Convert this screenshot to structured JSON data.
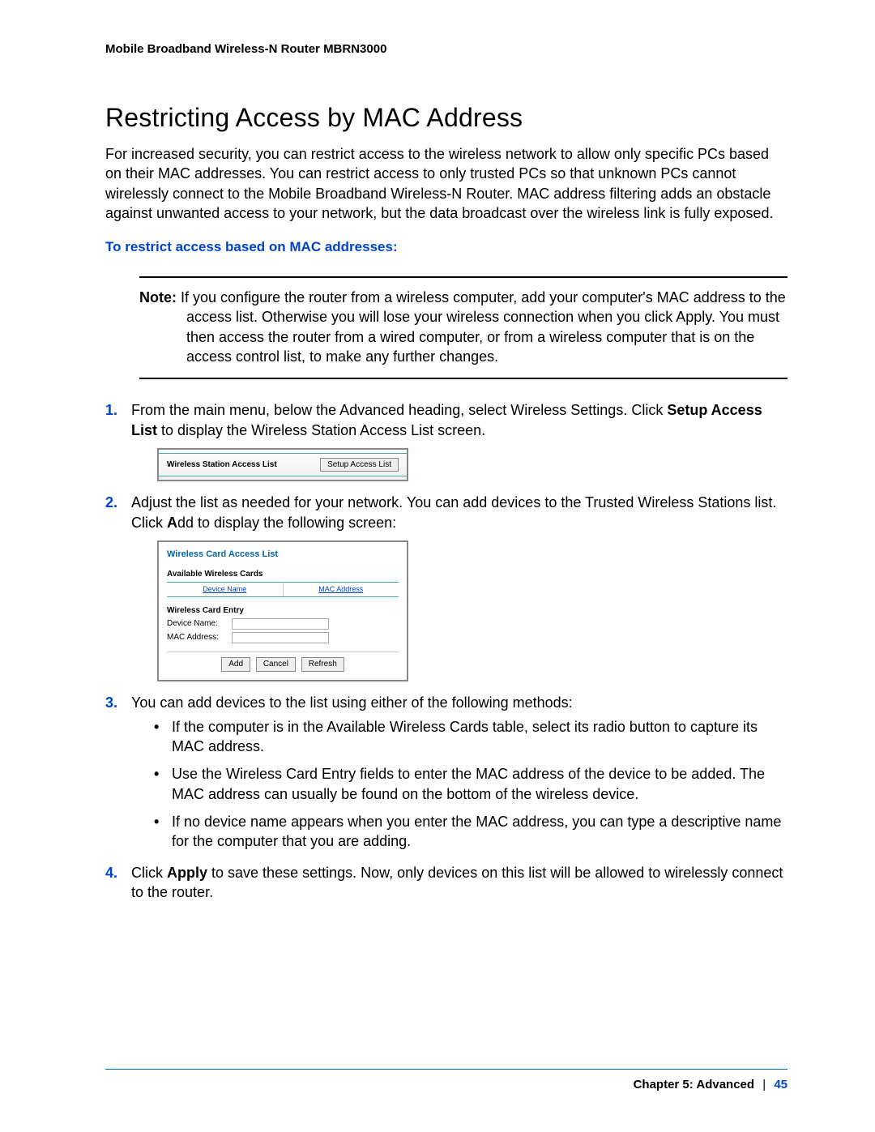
{
  "header": {
    "product": "Mobile Broadband Wireless-N Router MBRN3000"
  },
  "section": {
    "title": "Restricting Access by MAC Address",
    "intro": "For increased security, you can restrict access to the wireless network to allow only specific PCs based on their MAC addresses. You can restrict access to only trusted PCs so that unknown PCs cannot wirelessly connect to the Mobile Broadband Wireless-N Router. MAC address filtering adds an obstacle against unwanted access to your network, but the data broadcast over the wireless link is fully exposed.",
    "procedure_heading": "To restrict access based on MAC addresses:"
  },
  "note": {
    "label": "Note:",
    "text": "If you configure the router from a wireless computer, add your computer's MAC address to the access list. Otherwise you will lose your wireless connection when you click Apply. You must then access the router from a wired computer, or from a wireless computer that is on the access control list, to make any further changes."
  },
  "steps": {
    "s1_a": "From the main menu, below the Advanced heading, select Wireless Settings. Click ",
    "s1_bold": "Setup Access List",
    "s1_b": " to display the Wireless Station Access List screen.",
    "s2_a": "Adjust the list as needed for your network. You can add devices to the Trusted Wireless Stations list. Click ",
    "s2_bold": "A",
    "s2_b": "dd to display the following screen:",
    "s3": "You can add devices to the list using either of the following methods:",
    "s4_a": "Click ",
    "s4_bold": "Apply",
    "s4_b": " to save these settings. Now, only devices on this list will be allowed to wirelessly connect to the router."
  },
  "bullets": {
    "b1": "If the computer is in the Available Wireless Cards table, select its radio button to capture its MAC address.",
    "b2": "Use the Wireless Card Entry fields to enter the MAC address of the device to be added. The MAC address can usually be found on the bottom of the wireless device.",
    "b3": "If no device name appears when you enter the MAC address, you can type a descriptive name for the computer that you are adding."
  },
  "shot1": {
    "label": "Wireless Station Access List",
    "button": "Setup Access List"
  },
  "shot2": {
    "title": "Wireless Card Access List",
    "available": "Available Wireless Cards",
    "col1": "Device Name",
    "col2": "MAC Address",
    "entry": "Wireless Card Entry",
    "device_name_label": "Device Name:",
    "mac_label": "MAC Address:",
    "btn_add": "Add",
    "btn_cancel": "Cancel",
    "btn_refresh": "Refresh"
  },
  "footer": {
    "chapter": "Chapter 5:  Advanced",
    "sep": "|",
    "page": "45"
  }
}
